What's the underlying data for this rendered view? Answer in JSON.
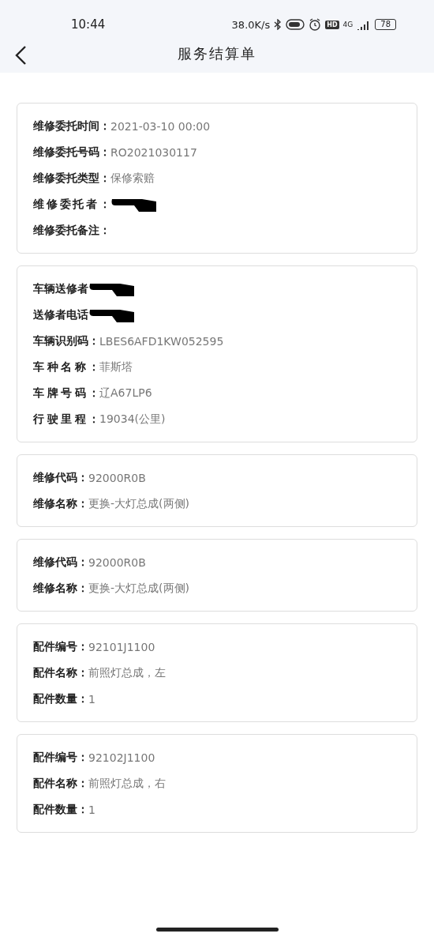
{
  "status_bar": {
    "time": "10:44",
    "speed": "38.0K/s",
    "hd": "HD",
    "network": "4G",
    "battery": "78"
  },
  "header": {
    "title": "服务结算单"
  },
  "cards": [
    {
      "rows": [
        {
          "kind": "text",
          "label": "维修委托时间：",
          "value": "2021-03-10 00:00"
        },
        {
          "kind": "text",
          "label": "维修委托号码：",
          "value": "RO2021030117"
        },
        {
          "kind": "text",
          "label": "维修委托类型：",
          "value": "保修索赔"
        },
        {
          "kind": "redacted",
          "label": "维修委托者："
        },
        {
          "kind": "text",
          "label": "维修委托备注："
        }
      ]
    },
    {
      "rows": [
        {
          "kind": "redacted",
          "label": "车辆送修者"
        },
        {
          "kind": "redacted",
          "label": "送修者电话"
        },
        {
          "kind": "text",
          "label": "车辆识别码：",
          "value": "LBES6AFD1KW052595"
        },
        {
          "kind": "text",
          "label": "车种名称：",
          "value": "菲斯塔"
        },
        {
          "kind": "text",
          "label": "车牌号码：",
          "value": "辽A67LP6"
        },
        {
          "kind": "text",
          "label": "行驶里程：",
          "value": "19034(公里)"
        }
      ]
    },
    {
      "rows": [
        {
          "kind": "text",
          "label": "维修代码：",
          "value": "92000R0B"
        },
        {
          "kind": "text",
          "label": "维修名称：",
          "value": "更换-大灯总成(两侧)"
        }
      ]
    },
    {
      "rows": [
        {
          "kind": "text",
          "label": "维修代码：",
          "value": "92000R0B"
        },
        {
          "kind": "text",
          "label": "维修名称：",
          "value": "更换-大灯总成(两侧)"
        }
      ]
    },
    {
      "rows": [
        {
          "kind": "text",
          "label": "配件编号：",
          "value": "92101J1100"
        },
        {
          "kind": "text",
          "label": "配件名称：",
          "value": "前照灯总成，左"
        },
        {
          "kind": "text",
          "label": "配件数量：",
          "value": "1"
        }
      ]
    },
    {
      "rows": [
        {
          "kind": "text",
          "label": "配件编号：",
          "value": "92102J1100"
        },
        {
          "kind": "text",
          "label": "配件名称：",
          "value": "前照灯总成，右"
        },
        {
          "kind": "text",
          "label": "配件数量：",
          "value": "1"
        }
      ]
    }
  ]
}
